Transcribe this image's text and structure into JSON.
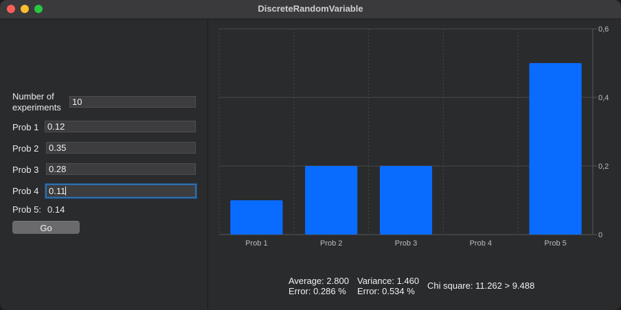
{
  "window": {
    "title": "DiscreteRandomVariable"
  },
  "form": {
    "experiments_label": "Number of experiments",
    "experiments_value": "10",
    "prob1_label": "Prob 1",
    "prob1_value": "0.12",
    "prob2_label": "Prob 2",
    "prob2_value": "0.35",
    "prob3_label": "Prob 3",
    "prob3_value": "0.28",
    "prob4_label": "Prob 4",
    "prob4_value": "0.11",
    "prob5_label": "Prob 5:",
    "prob5_value": "0.14",
    "go_label": "Go"
  },
  "chart_data": {
    "type": "bar",
    "categories": [
      "Prob 1",
      "Prob 2",
      "Prob 3",
      "Prob 4",
      "Prob 5"
    ],
    "values": [
      0.1,
      0.2,
      0.2,
      0,
      0.5
    ],
    "ylim": [
      0,
      0.6
    ],
    "yticks": [
      "0",
      "0,2",
      "0,4",
      "0,6"
    ],
    "y_axis_side": "right",
    "grid": true,
    "bar_color": "#0a6cff"
  },
  "stats": {
    "average": "Average: 2.800",
    "average_error": "Error: 0.286 %",
    "variance": "Variance: 1.460",
    "variance_error": "Error: 0.534 %",
    "chi_square": "Chi square: 11.262 > 9.488"
  }
}
